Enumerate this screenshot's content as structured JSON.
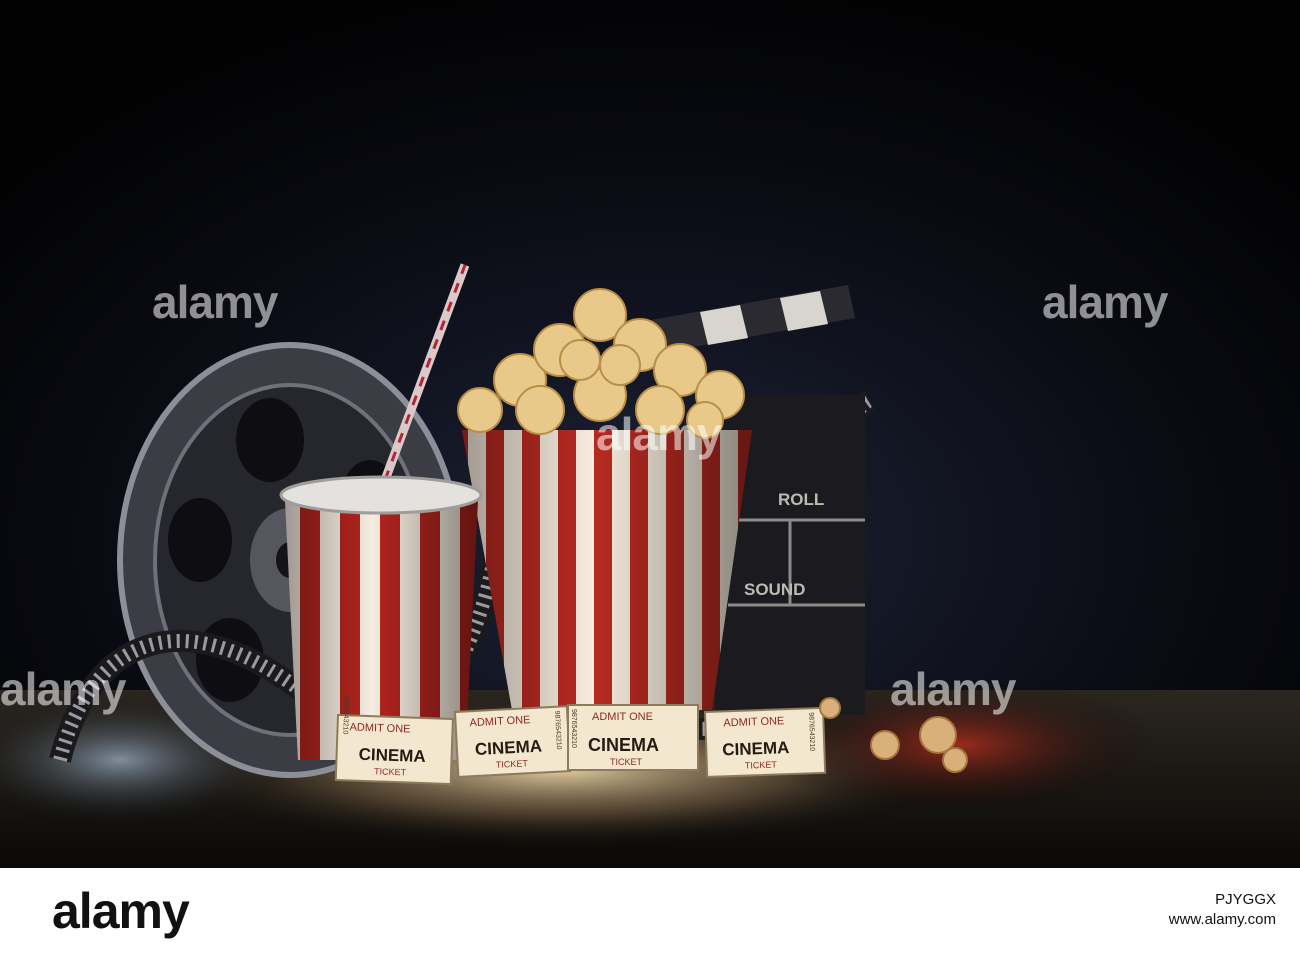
{
  "photo": {
    "clapper_labels": [
      "ROLL",
      "SOUND"
    ],
    "tickets": [
      {
        "top": "ADMIT ONE",
        "main": "CINEMA",
        "sub": "TICKET",
        "serial": "9876543210"
      },
      {
        "top": "ADMIT ONE",
        "main": "CINEMA",
        "sub": "TICKET",
        "serial": "9876543210"
      },
      {
        "top": "ADMIT ONE",
        "main": "CINEMA",
        "sub": "TICKET",
        "serial": "9876543210"
      },
      {
        "top": "ADMIT ONE",
        "main": "CINEMA",
        "sub": "TICKET",
        "serial": "9876543210"
      }
    ]
  },
  "watermark": {
    "text": "alamy"
  },
  "footer": {
    "logo": "alamy",
    "image_id": "PJYGGX",
    "site": "www.alamy.com"
  }
}
